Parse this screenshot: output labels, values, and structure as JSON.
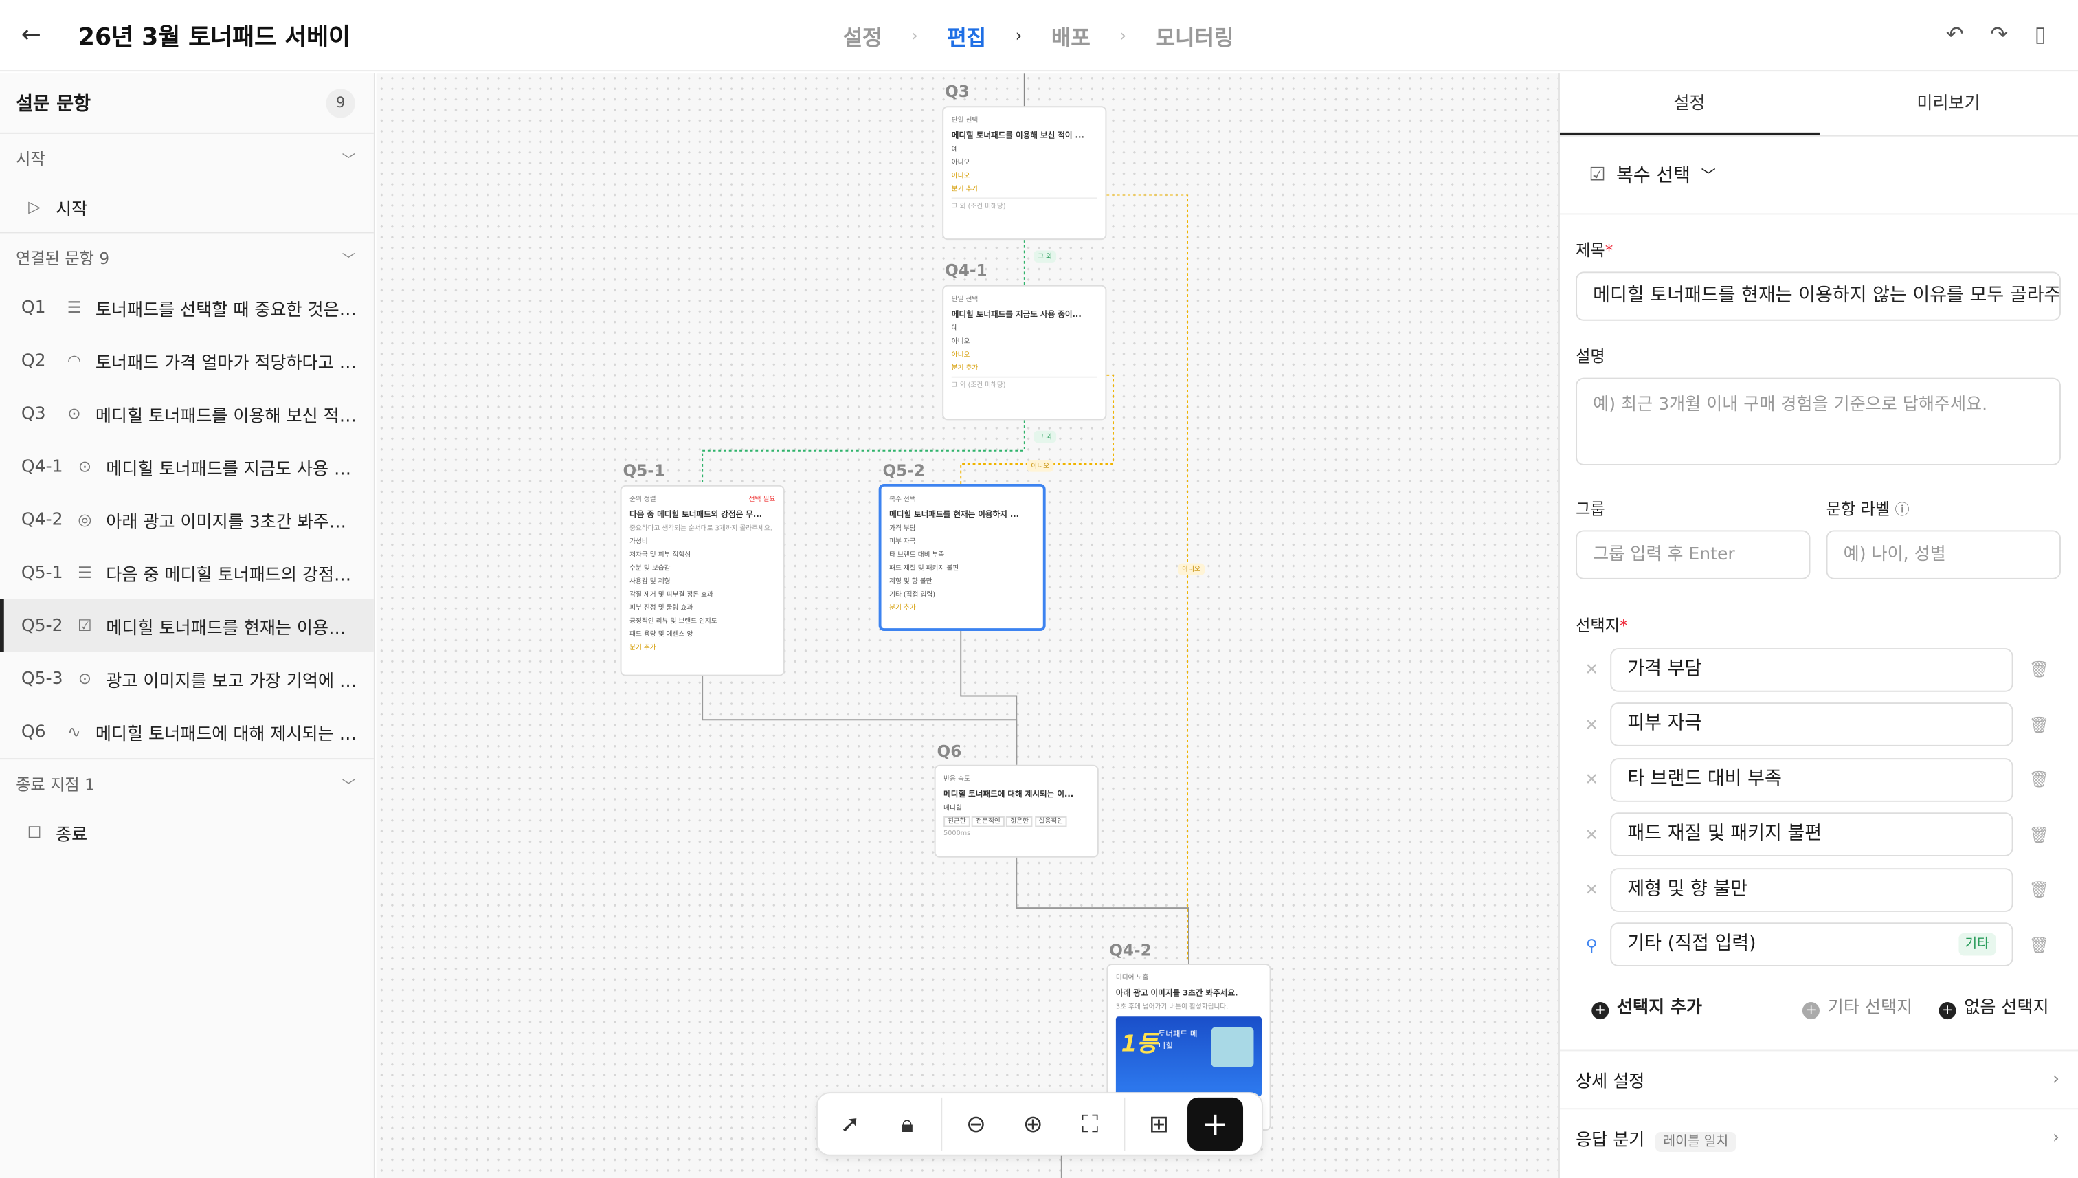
{
  "header": {
    "title": "26년 3월 토너패드 서베이",
    "steps": [
      "설정",
      "편집",
      "배포",
      "모니터링"
    ]
  },
  "left": {
    "title": "설문 문항",
    "count": "9",
    "start_section": "시작",
    "start_item": "시작",
    "linked_section": "연결된 문항",
    "linked_count": "9",
    "items": [
      {
        "q": "Q1",
        "label": "토너패드를 선택할 때 중요한 것은 무..."
      },
      {
        "q": "Q2",
        "label": "토너패드 가격 얼마가 적당하다고 생..."
      },
      {
        "q": "Q3",
        "label": "메디힐 토너패드를 이용해 보신 적이 ..."
      },
      {
        "q": "Q4-1",
        "label": "메디힐 토너패드를 지금도 사용 중..."
      },
      {
        "q": "Q4-2",
        "label": "아래 광고 이미지를 3초간 봐주세요."
      },
      {
        "q": "Q5-1",
        "label": "다음 중 메디힐 토너패드의 강점은 ..."
      },
      {
        "q": "Q5-2",
        "label": "메디힐 토너패드를 현재는 이용하..."
      },
      {
        "q": "Q5-3",
        "label": "광고 이미지를 보고 가장 기억에 남..."
      },
      {
        "q": "Q6",
        "label": "메디힐 토너패드에 대해 제시되는 이..."
      }
    ],
    "end_section": "종료 지점",
    "end_count": "1",
    "end_item": "종료"
  },
  "canvas": {
    "nodes": {
      "q3": {
        "label": "Q3",
        "type": "단일 선택",
        "title": "메디힐 토너패드를 이용해 보신 적이 ...",
        "opts": [
          "예",
          "아니오"
        ],
        "branch": "아니오",
        "add": "분기 추가",
        "foot": "그 외 (조건 미해당)"
      },
      "q41": {
        "label": "Q4-1",
        "type": "단일 선택",
        "title": "메디힐 토너패드를 지금도 사용 중이...",
        "opts": [
          "예",
          "아니오"
        ],
        "branch": "아니오",
        "add": "분기 추가",
        "foot": "그 외 (조건 미해당)"
      },
      "q51": {
        "label": "Q5-1",
        "type": "순위 정렬",
        "badge": "선택 필요",
        "title": "다음 중 메디힐 토너패드의 강점은 무...",
        "desc": "중요하다고 생각되는 순서대로 3개까지 골라주세요.",
        "opts": [
          "가성비",
          "저자극 및 피부 적합성",
          "수분 및 보습감",
          "사용감 및 제형",
          "각질 제거 및 피부결 정돈 효과",
          "피부 진정 및 쿨링 효과",
          "긍정적인 리뷰 및 브랜드 인지도",
          "패드 용량 및 에센스 양"
        ],
        "add": "분기 추가"
      },
      "q52": {
        "label": "Q5-2",
        "type": "복수 선택",
        "title": "메디힐 토너패드를 현재는 이용하지 ...",
        "opts": [
          "가격 부담",
          "피부 자극",
          "타 브랜드 대비 부족",
          "패드 재질 및 패키지 불편",
          "제형 및 향 불만",
          "기타 (직접 입력)"
        ],
        "add": "분기 추가"
      },
      "q6": {
        "label": "Q6",
        "type": "반응 속도",
        "title": "메디힐 토너패드에 대해 제시되는 이...",
        "brand": "메디힐",
        "chips": [
          "친근한",
          "전문적인",
          "젊은한",
          "실용적인"
        ],
        "time": "5000ms"
      },
      "q42": {
        "label": "Q4-2",
        "type": "미디어 노출",
        "title": "아래 광고 이미지를 3초간 봐주세요.",
        "desc": "3초 후에 넘어가기 버튼이 활성화됩니다.",
        "ad_big": "1등",
        "ad_brand": "토너패드 메디힐"
      }
    },
    "edge_tags": {
      "q3_yes": "그 외",
      "q41_yes": "그 외",
      "no": "아니오",
      "no2": "아니오"
    }
  },
  "right": {
    "tabs": [
      "설정",
      "미리보기"
    ],
    "qtype": "복수 선택",
    "title_label": "제목",
    "title_value": "메디힐 토너패드를 현재는 이용하지 않는 이유를 모두 골라주",
    "desc_label": "설명",
    "desc_placeholder": "예) 최근 3개월 이내 구매 경험을 기준으로 답해주세요.",
    "group_label": "그룹",
    "group_placeholder": "그룹 입력 후 Enter",
    "qlabel_label": "문항 라벨",
    "qlabel_placeholder": "예) 나이, 성별",
    "choices_label": "선택지",
    "choices": [
      "가격 부담",
      "피부 자극",
      "타 브랜드 대비 부족",
      "패드 재질 및 패키지 불편",
      "제형 및 향 불만",
      "기타 (직접 입력)"
    ],
    "etc_badge": "기타",
    "add_choice": "선택지 추가",
    "add_etc": "기타 선택지",
    "add_none": "없음 선택지",
    "detail": "상세 설정",
    "branch": "응답 분기",
    "branch_sub": "레이블 일치"
  }
}
